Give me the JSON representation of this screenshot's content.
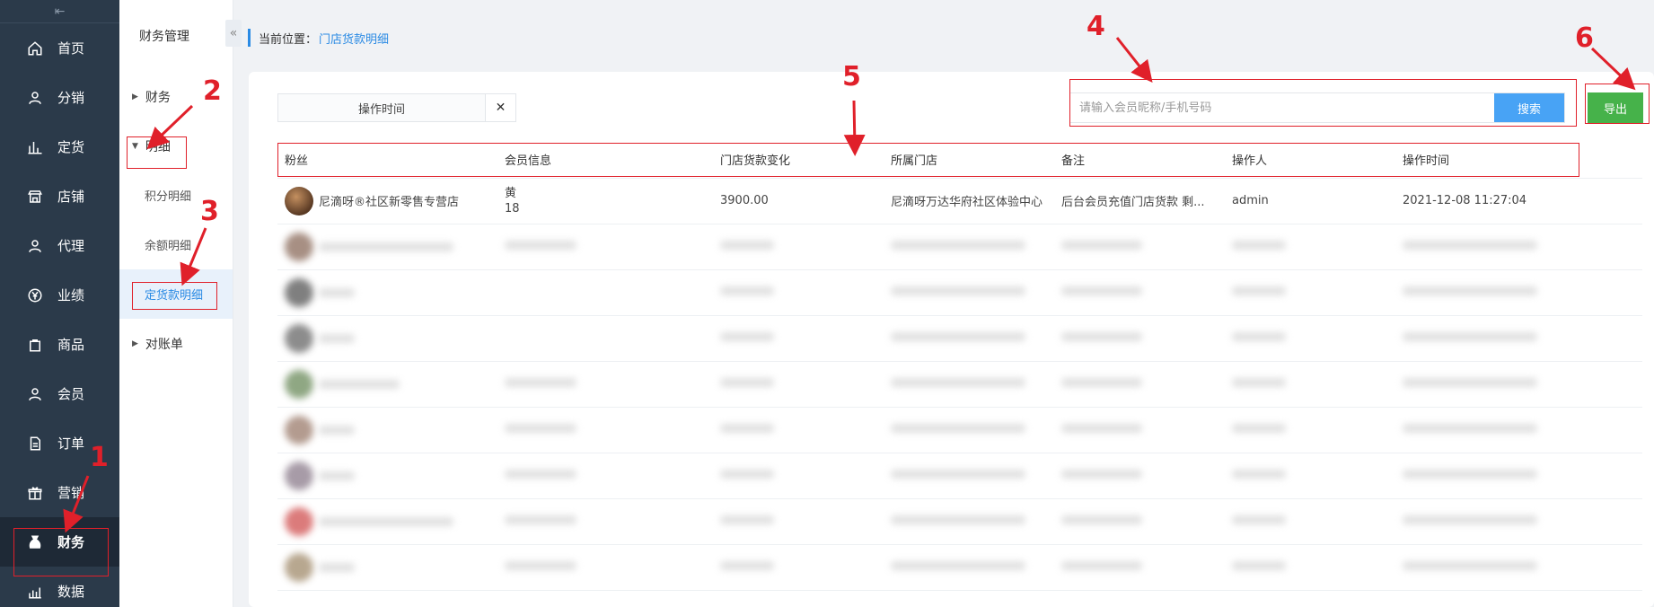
{
  "sidebar": {
    "items": [
      {
        "label": "首页",
        "icon": "home-icon"
      },
      {
        "label": "分销",
        "icon": "user-icon"
      },
      {
        "label": "定货",
        "icon": "bar-chart-icon"
      },
      {
        "label": "店铺",
        "icon": "shop-icon"
      },
      {
        "label": "代理",
        "icon": "user-icon"
      },
      {
        "label": "业绩",
        "icon": "yen-circle-icon"
      },
      {
        "label": "商品",
        "icon": "bag-icon"
      },
      {
        "label": "会员",
        "icon": "user-icon"
      },
      {
        "label": "订单",
        "icon": "document-icon"
      },
      {
        "label": "营销",
        "icon": "gift-icon"
      },
      {
        "label": "财务",
        "icon": "money-bag-icon",
        "active": true
      },
      {
        "label": "数据",
        "icon": "chart-icon"
      }
    ]
  },
  "submenu": {
    "title": "财务管理",
    "groups": [
      {
        "label": "财务"
      },
      {
        "label": "明细",
        "items": [
          {
            "label": "积分明细"
          },
          {
            "label": "余额明细"
          },
          {
            "label": "定货款明细",
            "active": true
          }
        ]
      },
      {
        "label": "对账单"
      }
    ]
  },
  "breadcrumb": {
    "prefix": "当前位置：",
    "current": "门店货款明细"
  },
  "filter": {
    "label": "操作时间"
  },
  "search": {
    "placeholder": "请输入会员昵称/手机号码",
    "button": "搜索"
  },
  "export": {
    "label": "导出"
  },
  "table": {
    "headers": [
      "粉丝",
      "会员信息",
      "门店货款变化",
      "所属门店",
      "备注",
      "操作人",
      "操作时间"
    ],
    "rows": [
      {
        "fan": "尼滴呀®社区新零售专营店",
        "member_line1": "黄",
        "member_line2": "18",
        "change": "3900.00",
        "store": "尼滴呀万达华府社区体验中心",
        "remark": "后台会员充值门店货款 剩...",
        "operator": "admin",
        "time": "2021-12-08 11:27:04"
      }
    ]
  },
  "annotations": [
    "1",
    "2",
    "3",
    "4",
    "5",
    "6"
  ],
  "colors": {
    "accent": "#2b8be4",
    "sidebar": "#2b3a4a",
    "search_btn": "#48a3f5",
    "export_btn": "#46b24a",
    "annotation": "#e0202a"
  }
}
